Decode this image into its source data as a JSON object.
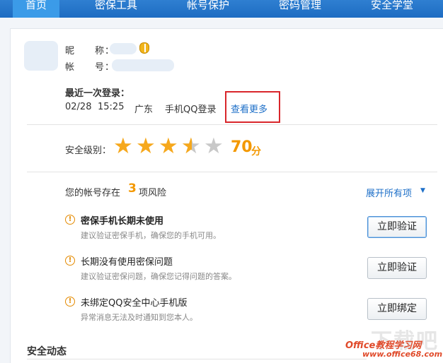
{
  "nav": {
    "items": [
      {
        "label": "首页",
        "active": true
      },
      {
        "label": "密保工具"
      },
      {
        "label": "帐号保护"
      },
      {
        "label": "密码管理"
      },
      {
        "label": "安全学堂"
      }
    ]
  },
  "profile": {
    "nickname_label": "昵　　称：",
    "account_label": "帐　　号："
  },
  "last_login": {
    "title": "最近一次登录：",
    "date": "02/28",
    "time": "15:25",
    "location": "广东",
    "device": "手机QQ登录",
    "more_link": "查看更多"
  },
  "security": {
    "level_label": "安全级别：",
    "stars_rating": 3.5,
    "stars_max": 5,
    "score": "70",
    "score_unit": "分",
    "colors": {
      "star_full": "#f6a81c",
      "star_empty": "#c8c8c8",
      "score": "#f39800"
    }
  },
  "risk": {
    "prefix": "您的帐号存在",
    "count": "3",
    "suffix": "项风险",
    "expand_label": "展开所有项",
    "expand_icon": "caret-down-icon",
    "items": [
      {
        "title": "密保手机长期未使用",
        "desc": "建议验证密保手机，确保您的手机可用。",
        "button": "立即验证"
      },
      {
        "title": "长期没有使用密保问题",
        "desc": "建议验证密保问题，确保您记得问题的答案。",
        "button": "立即验证"
      },
      {
        "title": "未绑定QQ安全中心手机版",
        "desc": "异常消息无法及时通知到您本人。",
        "button": "立即绑定"
      }
    ]
  },
  "dynamics": {
    "title": "安全动态"
  },
  "watermark": {
    "main": "下载吧",
    "brand": "Office教程学习网",
    "url": "www.office68.com"
  }
}
